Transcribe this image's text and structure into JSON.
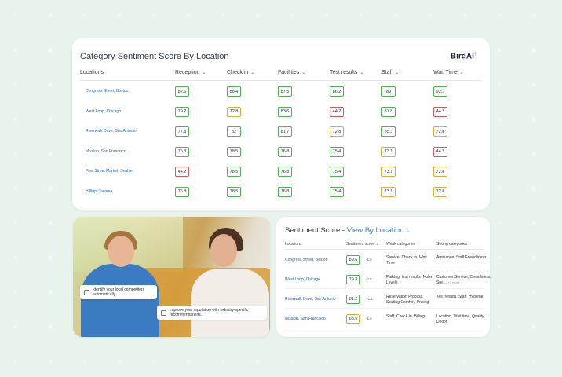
{
  "top": {
    "title": "Category Sentiment Score By Location",
    "brand": "BirdAI",
    "brand_mark": "+",
    "columns": [
      "Locations",
      "Reception",
      "Check in",
      "Facilities",
      "Test results",
      "Staff",
      "Wait Time"
    ],
    "chevron": "⌄",
    "rows": [
      {
        "location": "Congress Street, Boston",
        "scores": [
          "82.6",
          "88.4",
          "87.5",
          "86.2",
          "89",
          "92.1"
        ],
        "status": [
          "good",
          "good",
          "good",
          "good",
          "good",
          "good"
        ]
      },
      {
        "location": "West Loop, Chicago",
        "scores": [
          "79.2",
          "72.8",
          "83.6",
          "44.2",
          "87.8",
          "44.2"
        ],
        "status": [
          "good",
          "mid",
          "good",
          "bad",
          "good",
          "bad"
        ]
      },
      {
        "location": "Riverwalk Drive, San Antonio",
        "scores": [
          "77.8",
          "82",
          "81.7",
          "72.8",
          "85.3",
          "72.8"
        ],
        "status": [
          "good",
          "good",
          "good",
          "mid",
          "good",
          "mid"
        ]
      },
      {
        "location": "Mission, San Francisco",
        "scores": [
          "76.8",
          "78.5",
          "76.8",
          "75.4",
          "73.1",
          "44.2"
        ],
        "status": [
          "good",
          "good",
          "good",
          "good",
          "mid",
          "bad"
        ]
      },
      {
        "location": "Pine Street Market, Seattle",
        "scores": [
          "44.2",
          "78.5",
          "76.8",
          "75.4",
          "73.1",
          "72.8"
        ],
        "status": [
          "bad",
          "good",
          "good",
          "good",
          "mid",
          "mid"
        ]
      },
      {
        "location": "Hilltop, Tacoma",
        "scores": [
          "76.8",
          "78.5",
          "76.8",
          "75.4",
          "73.1",
          "72.8"
        ],
        "status": [
          "good",
          "good",
          "good",
          "good",
          "mid",
          "mid"
        ]
      }
    ]
  },
  "photo": {
    "callout1": "Identify your local competitors automatically",
    "callout2": "Improve your reputation with industry-specific recommendations."
  },
  "sentiment": {
    "title_prefix": "Sentiment Score - ",
    "title_link": "View By Location",
    "title_chevron": "⌄",
    "columns": [
      "Locations",
      "Sentiment score",
      "Weak categories",
      "Strong categories"
    ],
    "rows": [
      {
        "location": "Congress Street, Boston",
        "score": "89.6",
        "delta": "-1.5",
        "weak": "Service, Check In, Wait Time",
        "strong": "Ambiance, Staff Friendliness",
        "more": "",
        "status": "good"
      },
      {
        "location": "West Loop, Chicago",
        "score": "79.3",
        "delta": "-0.4",
        "weak": "Parking, test results, Noise Levels",
        "strong": "Customer Service, Cleanliness, Spe...",
        "more": "+1 more",
        "status": "good"
      },
      {
        "location": "Riverwalk Drive, San Antonio",
        "score": "81.2",
        "delta": "+0.1",
        "weak": "Reservation Process, Seating Comfort, Pricing",
        "strong": "Test results, Staff, Hygiene",
        "more": "",
        "status": "good"
      },
      {
        "location": "Mission, San Francisco",
        "score": "68.5",
        "delta": "-1.5",
        "weak": "Staff, Check In, Billing",
        "strong": "Location, Wait time, Quality, Décor",
        "more": "",
        "status": "mid"
      }
    ]
  },
  "colors": {
    "good": "#4cb552",
    "mid": "#e5a93a",
    "bad": "#e05252",
    "link": "#2563b5"
  }
}
